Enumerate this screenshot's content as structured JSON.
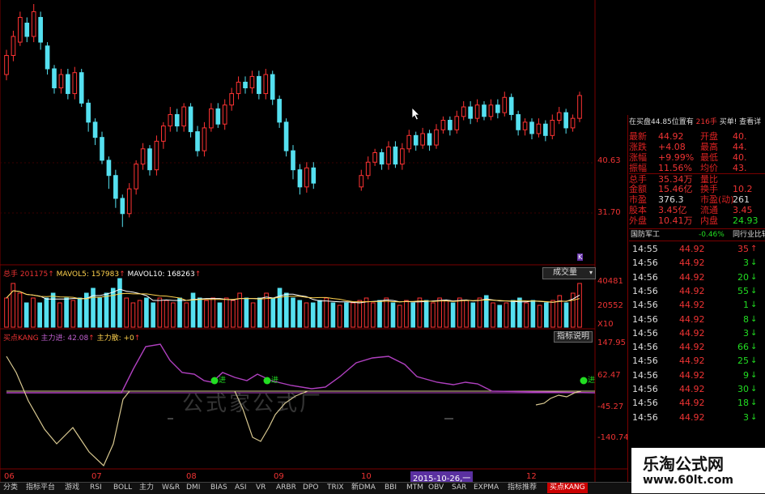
{
  "price_axis": {
    "high": "40.63",
    "low": "31.70"
  },
  "volume_header": {
    "total_label": "总手",
    "total_value": "201175",
    "mavol5_label": "MAVOL5:",
    "mavol5_value": "157983",
    "mavol10_label": "MAVOL10:",
    "mavol10_value": "168263",
    "dropdown": "成交量",
    "axis_top": "40481",
    "axis_mid": "20552",
    "axis_unit": "X10"
  },
  "indicator_header": {
    "name": "买点KANG",
    "line1_label": "主力进:",
    "line1_value": "42.08",
    "line2_label": "主力散:",
    "line2_value": "+0",
    "help_button": "指标说明",
    "axis": [
      "147.95",
      "62.47",
      "-45.27",
      "-140.74"
    ]
  },
  "signal_labels": [
    "进",
    "进",
    "进"
  ],
  "k_tag": "K",
  "watermark": "公式家公式厂",
  "x_axis": [
    "06",
    "07",
    "08",
    "09",
    "10",
    "11",
    "12"
  ],
  "x_cursor": "2015-10-26,一",
  "quote": {
    "header_left": "在买盘44.85位置有",
    "header_vol": "216手",
    "header_right": "买单! 查看详",
    "rows": [
      {
        "l": "最新",
        "v": "44.92",
        "l2": "开盘",
        "v2": "40."
      },
      {
        "l": "涨跌",
        "v": "+4.08",
        "l2": "最高",
        "v2": "44."
      },
      {
        "l": "涨幅",
        "v": "+9.99%",
        "l2": "最低",
        "v2": "40."
      },
      {
        "l": "振幅",
        "v": "11.56%",
        "l2": "均价",
        "v2": "43."
      },
      {
        "l": "总手",
        "v": "35.34万",
        "l2": "量比",
        "v2": ""
      },
      {
        "l": "金额",
        "v": "15.46亿",
        "l2": "换手",
        "v2": "10.2"
      },
      {
        "l": "市盈",
        "v": "376.3",
        "l2": "市盈(动)",
        "v2": "261"
      },
      {
        "l": "股本",
        "v": "3.45亿",
        "l2": "流通",
        "v2": "3.45"
      },
      {
        "l": "外盘",
        "v": "10.41万",
        "l2": "内盘",
        "v2": "24.93"
      }
    ],
    "sector": "国防军工",
    "sector_change": "-0.46%",
    "sector_link": "同行业比较"
  },
  "ticks": [
    {
      "t": "14:55",
      "p": "44.92",
      "v": "35",
      "d": "up"
    },
    {
      "t": "14:56",
      "p": "44.92",
      "v": "3",
      "d": "down"
    },
    {
      "t": "14:56",
      "p": "44.92",
      "v": "20",
      "d": "down"
    },
    {
      "t": "14:56",
      "p": "44.92",
      "v": "55",
      "d": "down"
    },
    {
      "t": "14:56",
      "p": "44.92",
      "v": "1",
      "d": "down"
    },
    {
      "t": "14:56",
      "p": "44.92",
      "v": "8",
      "d": "down"
    },
    {
      "t": "14:56",
      "p": "44.92",
      "v": "3",
      "d": "down"
    },
    {
      "t": "14:56",
      "p": "44.92",
      "v": "66",
      "d": "down"
    },
    {
      "t": "14:56",
      "p": "44.92",
      "v": "25",
      "d": "down"
    },
    {
      "t": "14:56",
      "p": "44.92",
      "v": "9",
      "d": "down"
    },
    {
      "t": "14:56",
      "p": "44.92",
      "v": "30",
      "d": "down"
    },
    {
      "t": "14:56",
      "p": "44.92",
      "v": "18",
      "d": "down"
    },
    {
      "t": "14:56",
      "p": "44.92",
      "v": "3",
      "d": "down"
    }
  ],
  "tabs": [
    "分类",
    "指标平台",
    "游戏",
    "RSI",
    "BOLL",
    "主力",
    "W&R",
    "DMI",
    "BIAS",
    "ASI",
    "VR",
    "ARBR",
    "DPO",
    "TRIX",
    "新DMA",
    "BBI",
    "MTM",
    "OBV",
    "SAR",
    "EXPMA",
    "指标推荐",
    "买点KANG"
  ],
  "logo": {
    "cn": "乐淘公式网",
    "url": "www.60lt.com"
  },
  "colors": {
    "up": "#ff3333",
    "down": "#55e0f0",
    "grid": "#7a0000",
    "ma_white": "#ffffff",
    "ma_yellow": "#ffd24d",
    "purple": "#b040c0",
    "khaki": "#d8c890",
    "green_dot": "#22dd22"
  },
  "candles": [
    [
      38.5,
      39.5,
      38.2,
      39.8
    ],
    [
      39.5,
      40.5,
      39.2,
      40.8
    ],
    [
      40.2,
      41.5,
      40.0,
      41.8
    ],
    [
      41.2,
      40.5,
      40.2,
      41.5
    ],
    [
      40.5,
      41.8,
      40.2,
      42.2
    ],
    [
      41.5,
      40.2,
      39.8,
      41.8
    ],
    [
      40.0,
      38.8,
      38.5,
      40.2
    ],
    [
      38.8,
      37.8,
      37.5,
      39.0
    ],
    [
      37.8,
      38.5,
      37.5,
      38.8
    ],
    [
      38.5,
      37.5,
      37.2,
      38.8
    ],
    [
      37.5,
      38.6,
      37.2,
      38.9
    ],
    [
      38.6,
      37.0,
      36.8,
      38.8
    ],
    [
      37.0,
      36.0,
      35.5,
      37.2
    ],
    [
      36.0,
      35.2,
      34.8,
      36.2
    ],
    [
      35.2,
      34.0,
      33.8,
      35.5
    ],
    [
      34.0,
      33.2,
      32.5,
      34.2
    ],
    [
      33.2,
      32.0,
      31.5,
      33.5
    ],
    [
      32.0,
      31.2,
      30.5,
      32.2
    ],
    [
      31.2,
      32.5,
      31.0,
      32.8
    ],
    [
      32.5,
      33.8,
      32.2,
      34.0
    ],
    [
      33.8,
      34.6,
      33.5,
      34.9
    ],
    [
      34.6,
      33.5,
      33.2,
      34.8
    ],
    [
      33.5,
      35.0,
      33.2,
      35.3
    ],
    [
      35.0,
      35.8,
      34.6,
      36.0
    ],
    [
      35.8,
      36.4,
      35.5,
      36.8
    ],
    [
      36.4,
      35.8,
      35.5,
      36.7
    ],
    [
      35.8,
      36.8,
      35.5,
      37.0
    ],
    [
      36.8,
      35.5,
      35.2,
      37.0
    ],
    [
      35.5,
      34.5,
      34.2,
      35.8
    ],
    [
      34.5,
      35.7,
      34.2,
      36.0
    ],
    [
      35.7,
      36.7,
      35.5,
      37.0
    ],
    [
      36.7,
      35.9,
      35.7,
      37.0
    ],
    [
      35.9,
      36.9,
      35.6,
      37.2
    ],
    [
      36.9,
      37.5,
      36.6,
      37.8
    ],
    [
      37.5,
      38.1,
      37.2,
      38.4
    ],
    [
      38.1,
      37.8,
      37.5,
      38.4
    ],
    [
      37.8,
      38.4,
      37.5,
      38.7
    ],
    [
      38.4,
      37.5,
      37.2,
      38.7
    ],
    [
      37.5,
      38.5,
      37.2,
      38.8
    ],
    [
      38.5,
      37.2,
      36.9,
      38.7
    ],
    [
      37.2,
      36.0,
      35.7,
      37.4
    ],
    [
      36.0,
      34.5,
      34.2,
      36.2
    ],
    [
      34.5,
      33.5,
      33.0,
      34.8
    ],
    [
      33.5,
      32.6,
      32.2,
      33.8
    ],
    [
      32.6,
      33.6,
      32.3,
      33.9
    ],
    [
      33.6,
      32.8,
      32.5,
      33.9
    ],
    [
      null,
      null,
      null,
      null
    ],
    [
      null,
      null,
      null,
      null
    ],
    [
      null,
      null,
      null,
      null
    ],
    [
      null,
      null,
      null,
      null
    ],
    [
      null,
      null,
      null,
      null
    ],
    [
      null,
      null,
      null,
      null
    ],
    [
      32.6,
      33.2,
      32.4,
      33.5
    ],
    [
      33.2,
      33.9,
      33.0,
      34.2
    ],
    [
      33.9,
      34.4,
      33.7,
      34.6
    ],
    [
      34.4,
      33.8,
      33.5,
      34.6
    ],
    [
      33.8,
      34.7,
      33.5,
      35.0
    ],
    [
      34.7,
      33.8,
      33.6,
      35.0
    ],
    [
      33.8,
      34.6,
      33.5,
      34.9
    ],
    [
      34.6,
      35.3,
      34.4,
      35.6
    ],
    [
      35.3,
      34.8,
      34.5,
      35.5
    ],
    [
      34.8,
      35.4,
      34.6,
      35.7
    ],
    [
      35.4,
      34.8,
      34.5,
      35.6
    ],
    [
      34.8,
      35.6,
      34.6,
      35.9
    ],
    [
      35.6,
      36.1,
      35.4,
      36.3
    ],
    [
      36.1,
      35.6,
      35.3,
      36.3
    ],
    [
      35.6,
      36.3,
      35.4,
      36.6
    ],
    [
      36.3,
      36.8,
      36.1,
      37.1
    ],
    [
      36.8,
      36.2,
      35.9,
      37.1
    ],
    [
      36.2,
      36.9,
      36.0,
      37.2
    ],
    [
      36.9,
      36.3,
      36.1,
      37.1
    ],
    [
      36.3,
      36.9,
      36.1,
      37.2
    ],
    [
      36.9,
      36.5,
      36.2,
      37.2
    ],
    [
      36.5,
      37.3,
      36.3,
      37.6
    ],
    [
      37.3,
      36.4,
      36.1,
      37.5
    ],
    [
      36.4,
      35.6,
      35.3,
      36.6
    ],
    [
      35.6,
      36.0,
      35.3,
      36.2
    ],
    [
      36.0,
      35.4,
      35.1,
      36.2
    ],
    [
      35.4,
      35.9,
      35.2,
      36.2
    ],
    [
      35.9,
      35.3,
      35.0,
      36.1
    ],
    [
      35.3,
      36.1,
      35.1,
      36.4
    ],
    [
      36.1,
      36.5,
      35.9,
      36.8
    ],
    [
      36.5,
      35.7,
      35.4,
      36.7
    ],
    [
      35.7,
      36.2,
      35.5,
      36.4
    ],
    [
      36.2,
      37.4,
      36.0,
      37.6
    ]
  ],
  "volumes": [
    0.6,
    0.9,
    0.7,
    0.5,
    0.6,
    0.5,
    0.6,
    0.7,
    0.5,
    0.6,
    0.55,
    0.6,
    0.7,
    0.8,
    0.6,
    0.7,
    0.8,
    1.0,
    0.6,
    0.5,
    0.55,
    0.6,
    0.5,
    0.6,
    0.55,
    0.5,
    0.6,
    0.5,
    0.7,
    0.6,
    0.55,
    0.6,
    0.5,
    0.6,
    0.55,
    0.7,
    0.6,
    0.5,
    0.6,
    0.7,
    0.6,
    0.8,
    0.7,
    0.6,
    0.55,
    0.5,
    0.5,
    0.55,
    0.6,
    0.5,
    0.45,
    0.5,
    0.5,
    0.55,
    0.6,
    0.5,
    0.55,
    0.6,
    0.5,
    0.45,
    0.55,
    0.5,
    0.6,
    0.55,
    0.5,
    0.6,
    0.55,
    0.5,
    0.6,
    0.55,
    0.5,
    0.6,
    0.65,
    0.5,
    0.45,
    0.5,
    0.55,
    0.6,
    0.5,
    0.55,
    0.45,
    0.5,
    0.55,
    0.65,
    0.5,
    0.7,
    0.9
  ]
}
